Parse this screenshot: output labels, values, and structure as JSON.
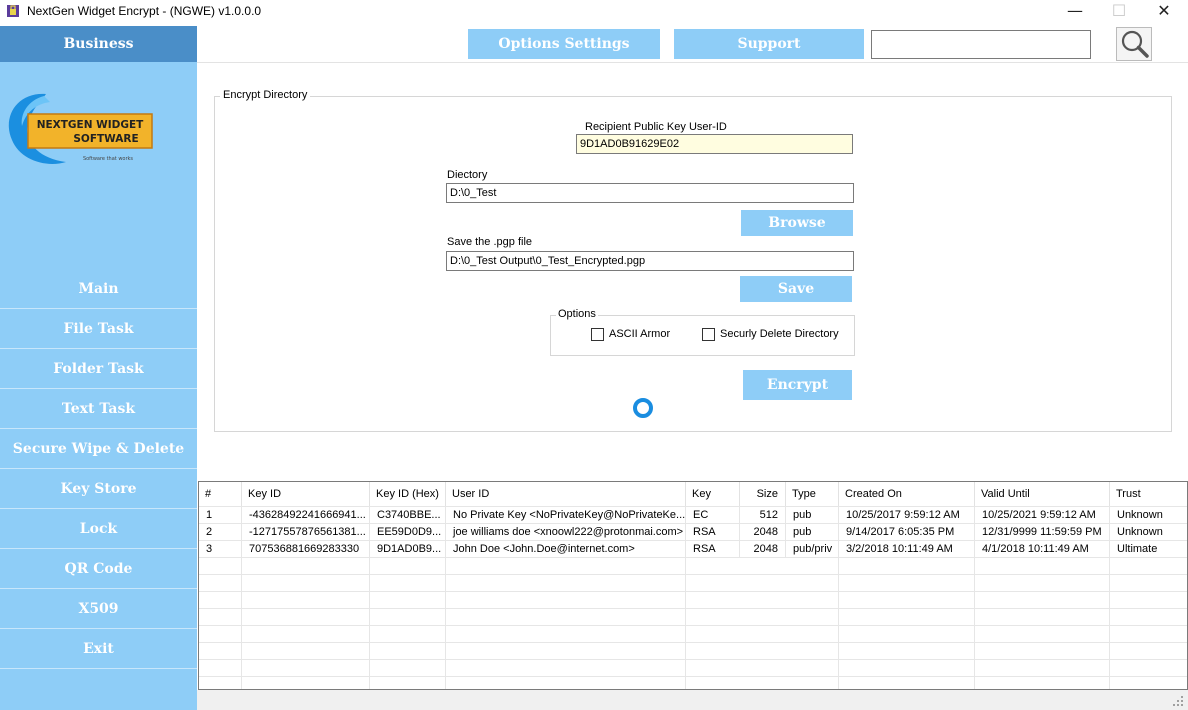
{
  "window": {
    "title": "NextGen Widget Encrypt - (NGWE) v1.0.0.0",
    "minimize": "—",
    "maximize": "☐",
    "close": "✕"
  },
  "sidebar": {
    "header": "Business",
    "logo": {
      "line1": "NEXTGEN WIDGET",
      "line2": "SOFTWARE",
      "tagline": "Software that works"
    },
    "items": [
      {
        "label": "Main"
      },
      {
        "label": "File Task"
      },
      {
        "label": "Folder Task"
      },
      {
        "label": "Text Task"
      },
      {
        "label": "Secure Wipe & Delete"
      },
      {
        "label": "Key Store"
      },
      {
        "label": "Lock"
      },
      {
        "label": "QR Code"
      },
      {
        "label": "X509"
      },
      {
        "label": "Exit"
      }
    ]
  },
  "topbar": {
    "options_label": "Options Settings",
    "support_label": "Support",
    "search_value": ""
  },
  "encrypt": {
    "group_title": "Encrypt Directory",
    "recipient_label": "Recipient Public Key User-ID",
    "recipient_value": "9D1AD0B91629E02",
    "directory_label": "Diectory",
    "directory_value": "D:\\0_Test",
    "browse_label": "Browse",
    "save_file_label": "Save the .pgp file",
    "save_file_value": "D:\\0_Test Output\\0_Test_Encrypted.pgp",
    "save_label": "Save",
    "options_title": "Options",
    "ascii_armor_label": "ASCII Armor",
    "secure_delete_label": "Securly Delete Directory",
    "encrypt_label": "Encrypt"
  },
  "keys_table": {
    "columns": [
      "#",
      "Key ID",
      "Key ID (Hex)",
      "User ID",
      "Key",
      "Size",
      "Type",
      "Created On",
      "Valid Until",
      "Trust"
    ],
    "rows": [
      [
        "1",
        "-43628492241666941...",
        "C3740BBE...",
        "No Private Key <NoPrivateKey@NoPrivateKe...",
        "EC",
        "512",
        "pub",
        "10/25/2017 9:59:12 AM",
        "10/25/2021 9:59:12 AM",
        "Unknown"
      ],
      [
        "2",
        "-12717557876561381...",
        "EE59D0D9...",
        "joe williams doe <xnoowl222@protonmai.com>",
        "RSA",
        "2048",
        "pub",
        "9/14/2017 6:05:35 PM",
        "12/31/9999 11:59:59 PM",
        "Unknown"
      ],
      [
        "3",
        "707536881669283330",
        "9D1AD0B9...",
        "John Doe <John.Doe@internet.com>",
        "RSA",
        "2048",
        "pub/priv",
        "3/2/2018 10:11:49 AM",
        "4/1/2018 10:11:49 AM",
        "Ultimate"
      ]
    ]
  },
  "colors": {
    "sidebar_bg": "#8ecdf7",
    "sidebar_header_bg": "#4a8ec8",
    "button_bg": "#8ecdf7",
    "spinner": "#1a8de0"
  }
}
